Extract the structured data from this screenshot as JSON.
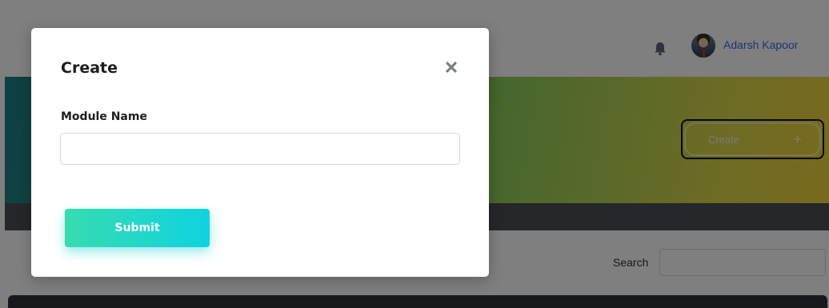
{
  "header": {
    "user_name": "Adarsh Kapoor",
    "bell_icon": "bell-icon"
  },
  "hero": {
    "create_label": "Create",
    "create_icon": "+"
  },
  "content": {
    "search_label": "Search",
    "search_value": ""
  },
  "modal": {
    "title": "Create",
    "close_icon": "✖",
    "field_label": "Module Name",
    "field_value": "",
    "submit_label": "Submit"
  },
  "colors": {
    "accent_gradient_start": "#37dcb0",
    "accent_gradient_end": "#0fd3e0",
    "username": "#2f6de6",
    "dark_bar": "#2f333b"
  }
}
